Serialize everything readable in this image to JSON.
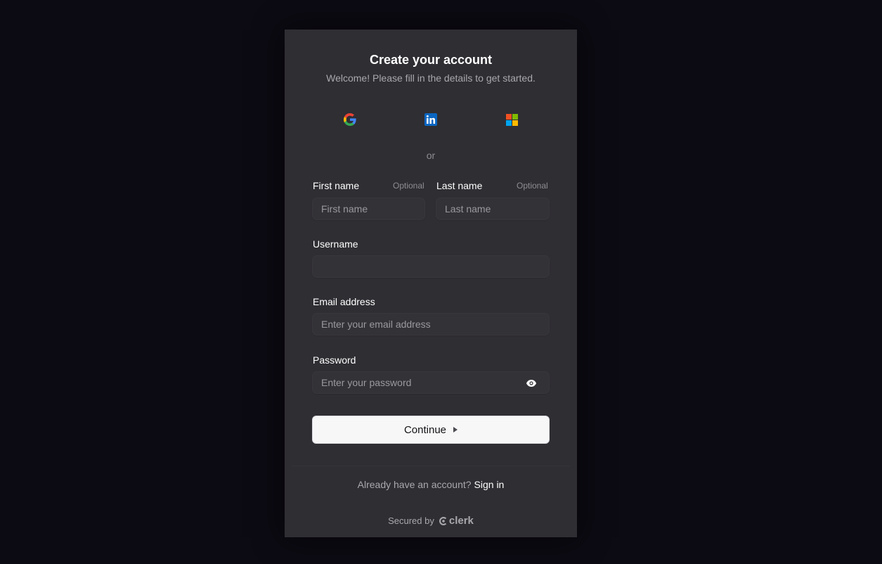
{
  "header": {
    "title": "Create your account",
    "subtitle": "Welcome! Please fill in the details to get started."
  },
  "social": [
    {
      "provider": "Google",
      "icon": "google-icon"
    },
    {
      "provider": "LinkedIn",
      "icon": "linkedin-icon"
    },
    {
      "provider": "Microsoft",
      "icon": "microsoft-icon"
    }
  ],
  "divider_text": "or",
  "form": {
    "first_name": {
      "label": "First name",
      "optional": "Optional",
      "placeholder": "First name",
      "value": ""
    },
    "last_name": {
      "label": "Last name",
      "optional": "Optional",
      "placeholder": "Last name",
      "value": ""
    },
    "username": {
      "label": "Username",
      "placeholder": "",
      "value": ""
    },
    "email": {
      "label": "Email address",
      "placeholder": "Enter your email address",
      "value": ""
    },
    "password": {
      "label": "Password",
      "placeholder": "Enter your password",
      "value": "",
      "toggle_icon": "eye-icon"
    }
  },
  "continue_label": "Continue",
  "footer": {
    "prompt": "Already have an account?",
    "link": "Sign in",
    "secured_by": "Secured by",
    "brand": "clerk"
  },
  "colors": {
    "background": "#0c0a12",
    "card": "#2f2e33",
    "primary_button": "#f7f7f8"
  }
}
